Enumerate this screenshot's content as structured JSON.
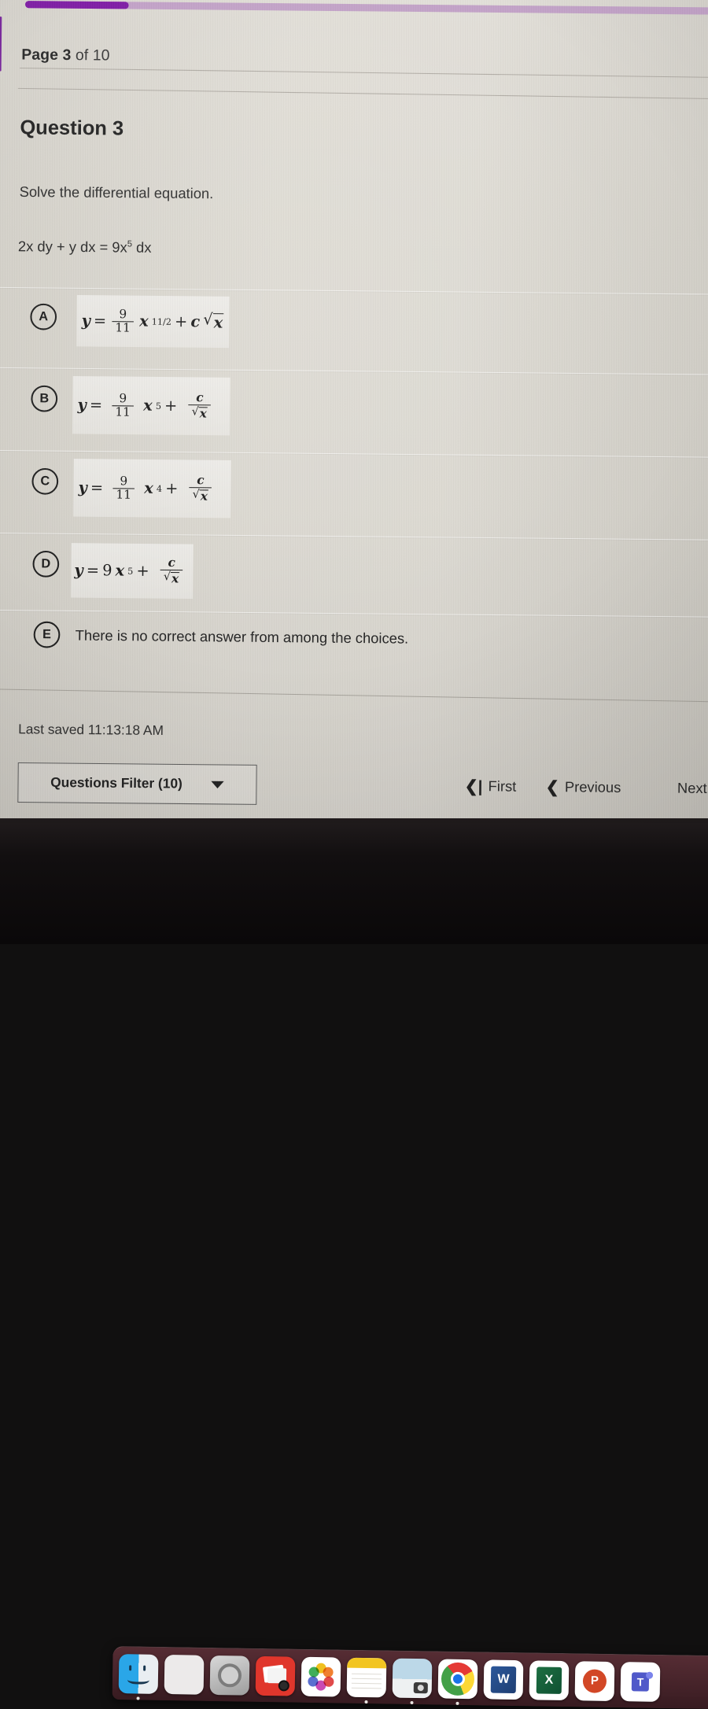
{
  "progress": {
    "percent": 15,
    "fill_color": "#8120a6",
    "track_color": "#c3a3c8"
  },
  "header": {
    "page_prefix": "Page",
    "page_current": "3",
    "page_middle": "of",
    "page_total": "10",
    "page_label_full": "Page 3 of 10"
  },
  "question": {
    "title": "Question 3",
    "prompt": "Solve the differential equation.",
    "equation_plain": "2x dy + y dx = 9x5 dx",
    "equation": {
      "lead": "2x dy + y dx = 9x",
      "exp": "5",
      "tail": " dx"
    }
  },
  "choices": [
    {
      "letter": "A",
      "type": "formula",
      "formula_plain": "y = (9/11) x^11/2 + c sqrt(x)",
      "parts": {
        "y": "y",
        "eq": "=",
        "num": "9",
        "den": "11",
        "var": "x",
        "exp": "11/2",
        "plus": "+",
        "coef": "c",
        "radicand": "x"
      }
    },
    {
      "letter": "B",
      "type": "formula",
      "formula_plain": "y = (9/11) x^5 + c / sqrt(x)",
      "parts": {
        "y": "y",
        "eq": "=",
        "num": "9",
        "den": "11",
        "var": "x",
        "exp": "5",
        "plus": "+",
        "coef": "c",
        "radicand": "x"
      }
    },
    {
      "letter": "C",
      "type": "formula",
      "formula_plain": "y = (9/11) x^4 + c / sqrt(x)",
      "parts": {
        "y": "y",
        "eq": "=",
        "num": "9",
        "den": "11",
        "var": "x",
        "exp": "4",
        "plus": "+",
        "coef": "c",
        "radicand": "x"
      }
    },
    {
      "letter": "D",
      "type": "formula",
      "formula_plain": "y = 9x^5 + c / sqrt(x)",
      "parts": {
        "y": "y",
        "eq": "=",
        "coefficient": "9",
        "var": "x",
        "exp": "5",
        "plus": "+",
        "coef": "c",
        "radicand": "x"
      }
    },
    {
      "letter": "E",
      "type": "text",
      "text": "There is no correct answer from among the choices."
    }
  ],
  "footer": {
    "last_saved": "Last saved 11:13:18 AM",
    "filter_label": "Questions Filter (10)",
    "nav": {
      "first": "First",
      "first_glyph": "❮|",
      "previous": "Previous",
      "previous_glyph": "❮",
      "next": "Next"
    }
  },
  "dock": {
    "items": [
      {
        "name": "finder",
        "label": "Finder",
        "running": true
      },
      {
        "name": "launchpad",
        "label": "Launchpad",
        "running": false
      },
      {
        "name": "system-preferences",
        "label": "System Preferences",
        "running": false
      },
      {
        "name": "image-capture",
        "label": "Image Capture",
        "running": false
      },
      {
        "name": "photos",
        "label": "Photos",
        "running": false
      },
      {
        "name": "notes",
        "label": "Notes",
        "running": true
      },
      {
        "name": "preview",
        "label": "Preview",
        "running": true
      },
      {
        "name": "chrome",
        "label": "Google Chrome",
        "running": true
      },
      {
        "name": "word",
        "label": "W",
        "running": false
      },
      {
        "name": "excel",
        "label": "X",
        "running": false
      },
      {
        "name": "powerpoint",
        "label": "P",
        "running": false
      },
      {
        "name": "teams",
        "label": "T",
        "running": false
      }
    ]
  }
}
